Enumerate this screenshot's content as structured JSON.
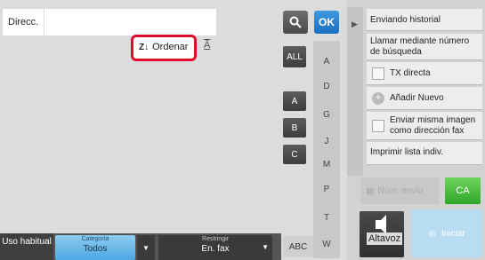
{
  "address": {
    "label": "Direcc.",
    "value": ""
  },
  "toolbar": {
    "ok_label": "OK",
    "sort_label": "Ordenar",
    "text_size_glyph": "Ā",
    "all_label": "ALL"
  },
  "side_letters": [
    "A",
    "B",
    "C"
  ],
  "index_letters": [
    "A",
    "D",
    "G",
    "J",
    "M",
    "P",
    "T",
    "W"
  ],
  "abc_label": "ABC",
  "bottom": {
    "freq_label": "Uso habitual",
    "category_caption": "Categoría",
    "category_value": "Todos",
    "restrict_caption": "Restringir",
    "restrict_value": "En. fax"
  },
  "menu": {
    "history": "Enviando historial",
    "search_number": "Llamar mediante número de búsqueda",
    "direct_tx": "TX directa",
    "add_new": "Añadir Nuevo",
    "same_image": "Enviar misma imagen como dirección  fax",
    "print_list": "Imprimir lista indiv."
  },
  "actions": {
    "ca_label": "CA",
    "speaker_label": "Altavoz",
    "number_label": "Núm. envío",
    "start_label": "Iniciar"
  },
  "colors": {
    "ok": "#1a6fc0",
    "highlight": "#e0102a",
    "ca": "#2ea82a",
    "category": "#4aa8e3"
  },
  "icons": [
    "search-icon",
    "sort-icon",
    "text-size-icon",
    "collapse-icon",
    "speaker-icon",
    "start-icon",
    "fax-number-icon"
  ]
}
